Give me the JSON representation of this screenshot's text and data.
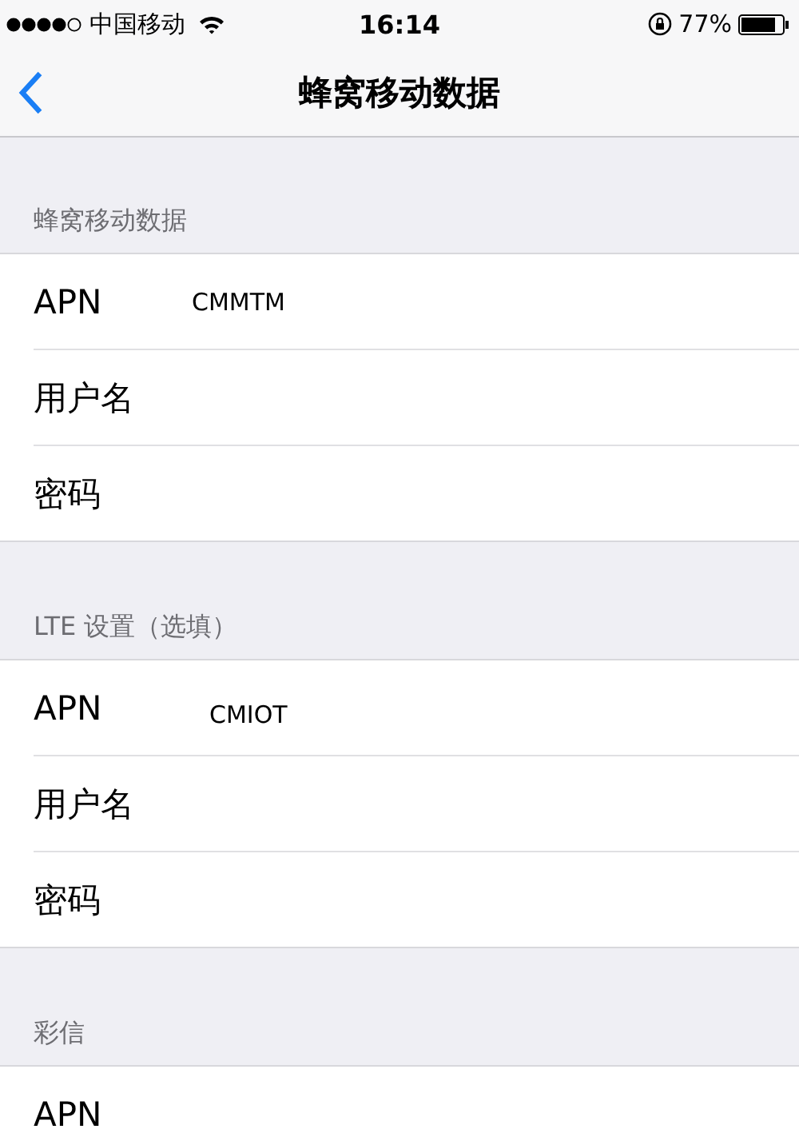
{
  "status_bar": {
    "carrier": "中国移动",
    "time": "16:14",
    "battery": "77%"
  },
  "nav": {
    "title": "蜂窝移动数据"
  },
  "sections": [
    {
      "header": "蜂窝移动数据",
      "rows": [
        {
          "label": "APN",
          "value": "CMMTM"
        },
        {
          "label": "用户名"
        },
        {
          "label": "密码"
        }
      ]
    },
    {
      "header": "LTE 设置（选填）",
      "rows": [
        {
          "label": "APN",
          "value": "CMIOT"
        },
        {
          "label": "用户名"
        },
        {
          "label": "密码"
        }
      ]
    },
    {
      "header": "彩信",
      "rows": [
        {
          "label": "APN"
        }
      ]
    }
  ]
}
